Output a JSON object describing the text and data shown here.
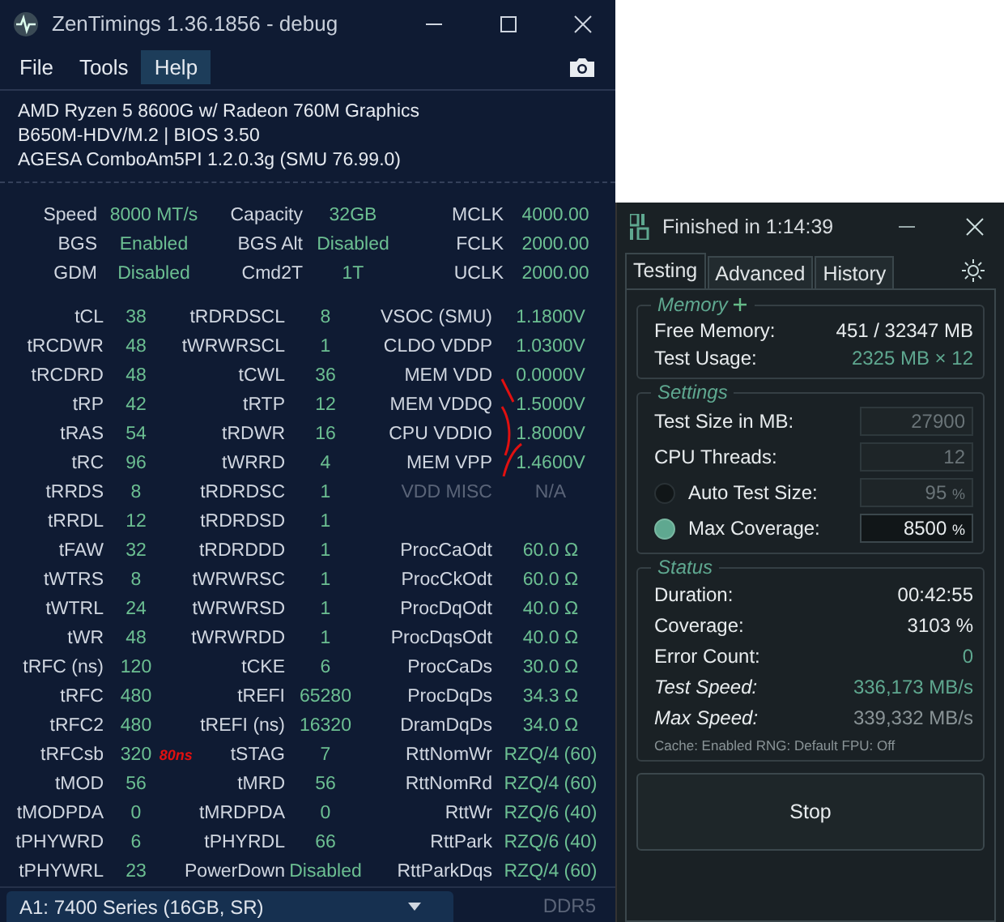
{
  "main_window": {
    "title": "ZenTimings 1.36.1856 - debug",
    "menu": [
      {
        "label": "File",
        "selected": false
      },
      {
        "label": "Tools",
        "selected": false
      },
      {
        "label": "Help",
        "selected": true
      }
    ],
    "system_info": [
      "AMD Ryzen 5 8600G w/ Radeon 760M Graphics",
      "B650M-HDV/M.2 | BIOS 3.50",
      "AGESA ComboAm5PI 1.2.0.3g (SMU 76.99.0)"
    ],
    "summary_rows": [
      [
        {
          "label": "Speed",
          "value": "8000 MT/s",
          "disabled": false
        },
        {
          "label": "Capacity",
          "value": "32GB",
          "disabled": false
        },
        {
          "label": "MCLK",
          "value": "4000.00",
          "disabled": false
        }
      ],
      [
        {
          "label": "BGS",
          "value": "Enabled",
          "disabled": false
        },
        {
          "label": "BGS Alt",
          "value": "Disabled",
          "disabled": false
        },
        {
          "label": "FCLK",
          "value": "2000.00",
          "disabled": false
        }
      ],
      [
        {
          "label": "GDM",
          "value": "Disabled",
          "disabled": false
        },
        {
          "label": "Cmd2T",
          "value": "1T",
          "disabled": false
        },
        {
          "label": "UCLK",
          "value": "2000.00",
          "disabled": false
        }
      ]
    ],
    "timing_rows": [
      [
        {
          "label": "tCL",
          "value": "38",
          "disabled": false
        },
        {
          "label": "tRDRDSCL",
          "value": "8",
          "disabled": false
        },
        {
          "label": "VSOC (SMU)",
          "value": "1.1800V",
          "disabled": false
        }
      ],
      [
        {
          "label": "tRCDWR",
          "value": "48",
          "disabled": false
        },
        {
          "label": "tWRWRSCL",
          "value": "1",
          "disabled": false
        },
        {
          "label": "CLDO VDDP",
          "value": "1.0300V",
          "disabled": false
        }
      ],
      [
        {
          "label": "tRCDRD",
          "value": "48",
          "disabled": false
        },
        {
          "label": "tCWL",
          "value": "36",
          "disabled": false
        },
        {
          "label": "MEM VDD",
          "value": "0.0000V",
          "disabled": false
        }
      ],
      [
        {
          "label": "tRP",
          "value": "42",
          "disabled": false
        },
        {
          "label": "tRTP",
          "value": "12",
          "disabled": false
        },
        {
          "label": "MEM VDDQ",
          "value": "1.5000V",
          "disabled": false
        }
      ],
      [
        {
          "label": "tRAS",
          "value": "54",
          "disabled": false
        },
        {
          "label": "tRDWR",
          "value": "16",
          "disabled": false
        },
        {
          "label": "CPU VDDIO",
          "value": "1.8000V",
          "disabled": false
        }
      ],
      [
        {
          "label": "tRC",
          "value": "96",
          "disabled": false
        },
        {
          "label": "tWRRD",
          "value": "4",
          "disabled": false
        },
        {
          "label": "MEM VPP",
          "value": "1.4600V",
          "disabled": false
        }
      ],
      [
        {
          "label": "tRRDS",
          "value": "8",
          "disabled": false
        },
        {
          "label": "tRDRDSC",
          "value": "1",
          "disabled": false
        },
        {
          "label": "VDD MISC",
          "value": "N/A",
          "disabled": true
        }
      ],
      [
        {
          "label": "tRRDL",
          "value": "12",
          "disabled": false
        },
        {
          "label": "tRDRDSD",
          "value": "1",
          "disabled": false
        }
      ],
      [
        {
          "label": "tFAW",
          "value": "32",
          "disabled": false
        },
        {
          "label": "tRDRDDD",
          "value": "1",
          "disabled": false
        },
        {
          "label": "ProcCaOdt",
          "value": "60.0 Ω",
          "disabled": false
        }
      ],
      [
        {
          "label": "tWTRS",
          "value": "8",
          "disabled": false
        },
        {
          "label": "tWRWRSC",
          "value": "1",
          "disabled": false
        },
        {
          "label": "ProcCkOdt",
          "value": "60.0 Ω",
          "disabled": false
        }
      ],
      [
        {
          "label": "tWTRL",
          "value": "24",
          "disabled": false
        },
        {
          "label": "tWRWRSD",
          "value": "1",
          "disabled": false
        },
        {
          "label": "ProcDqOdt",
          "value": "40.0 Ω",
          "disabled": false
        }
      ],
      [
        {
          "label": "tWR",
          "value": "48",
          "disabled": false
        },
        {
          "label": "tWRWRDD",
          "value": "1",
          "disabled": false
        },
        {
          "label": "ProcDqsOdt",
          "value": "40.0 Ω",
          "disabled": false
        }
      ],
      [
        {
          "label": "tRFC (ns)",
          "value": "120",
          "disabled": false
        },
        {
          "label": "tCKE",
          "value": "6",
          "disabled": false
        },
        {
          "label": "ProcCaDs",
          "value": "30.0 Ω",
          "disabled": false
        }
      ],
      [
        {
          "label": "tRFC",
          "value": "480",
          "disabled": false
        },
        {
          "label": "tREFI",
          "value": "65280",
          "disabled": false
        },
        {
          "label": "ProcDqDs",
          "value": "34.3 Ω",
          "disabled": false
        }
      ],
      [
        {
          "label": "tRFC2",
          "value": "480",
          "disabled": false
        },
        {
          "label": "tREFI (ns)",
          "value": "16320",
          "disabled": false
        },
        {
          "label": "DramDqDs",
          "value": "34.0 Ω",
          "disabled": false
        }
      ],
      [
        {
          "label": "tRFCsb",
          "value": "320",
          "disabled": false
        },
        {
          "label": "tSTAG",
          "value": "7",
          "disabled": false
        },
        {
          "label": "RttNomWr",
          "value": "RZQ/4 (60)",
          "disabled": false
        }
      ],
      [
        {
          "label": "tMOD",
          "value": "56",
          "disabled": false
        },
        {
          "label": "tMRD",
          "value": "56",
          "disabled": false
        },
        {
          "label": "RttNomRd",
          "value": "RZQ/4 (60)",
          "disabled": false
        }
      ],
      [
        {
          "label": "tMODPDA",
          "value": "0",
          "disabled": false
        },
        {
          "label": "tMRDPDA",
          "value": "0",
          "disabled": false
        },
        {
          "label": "RttWr",
          "value": "RZQ/6 (40)",
          "disabled": false
        }
      ],
      [
        {
          "label": "tPHYWRD",
          "value": "6",
          "disabled": false
        },
        {
          "label": "tPHYRDL",
          "value": "66",
          "disabled": false
        },
        {
          "label": "RttPark",
          "value": "RZQ/6 (40)",
          "disabled": false
        }
      ],
      [
        {
          "label": "tPHYWRL",
          "value": "23",
          "disabled": false
        },
        {
          "label": "PowerDown",
          "value": "Disabled",
          "disabled": false
        },
        {
          "label": "RttParkDqs",
          "value": "RZQ/4 (60)",
          "disabled": false
        }
      ]
    ],
    "handwritten_note": "80ns",
    "module_select": {
      "value": "A1: 7400 Series (16GB, SR)"
    },
    "memory_type": "DDR5"
  },
  "test_window": {
    "title": "Finished in 1:14:39",
    "tabs": [
      {
        "label": "Testing",
        "selected": true
      },
      {
        "label": "Advanced",
        "selected": false
      },
      {
        "label": "History",
        "selected": false
      }
    ],
    "memory": {
      "title": "Memory",
      "rows": [
        {
          "label": "Free Memory:",
          "value": "451 / 32347 MB",
          "highlight": false
        },
        {
          "label": "Test Usage:",
          "value": "2325 MB × 12",
          "highlight": true
        }
      ]
    },
    "settings": {
      "title": "Settings",
      "rows": [
        {
          "kind": "field",
          "label": "Test Size in MB:",
          "value": "27900",
          "active": false
        },
        {
          "kind": "field",
          "label": "CPU Threads:",
          "value": "12",
          "active": false
        },
        {
          "kind": "radio",
          "label": "Auto Test Size:",
          "value": "95",
          "unit": "%",
          "selected": false
        },
        {
          "kind": "radio",
          "label": "Max Coverage:",
          "value": "8500",
          "unit": "%",
          "selected": true
        }
      ]
    },
    "status": {
      "title": "Status",
      "rows": [
        {
          "label": "Duration:",
          "value": "00:42:55",
          "italic": false,
          "color": "#e8ecee"
        },
        {
          "label": "Coverage:",
          "value": "3103 %",
          "italic": false,
          "color": "#e8ecee"
        },
        {
          "label": "Error Count:",
          "value": "0",
          "italic": false,
          "color": "#5fa890"
        },
        {
          "label": "Test Speed:",
          "value": "336,173 MB/s",
          "italic": true,
          "color": "#5fa890"
        },
        {
          "label": "Max Speed:",
          "value": "339,332 MB/s",
          "italic": true,
          "color": "#8a9497"
        }
      ],
      "footer": "Cache: Enabled  RNG: Default  FPU: Off"
    },
    "stop_button": "Stop"
  }
}
